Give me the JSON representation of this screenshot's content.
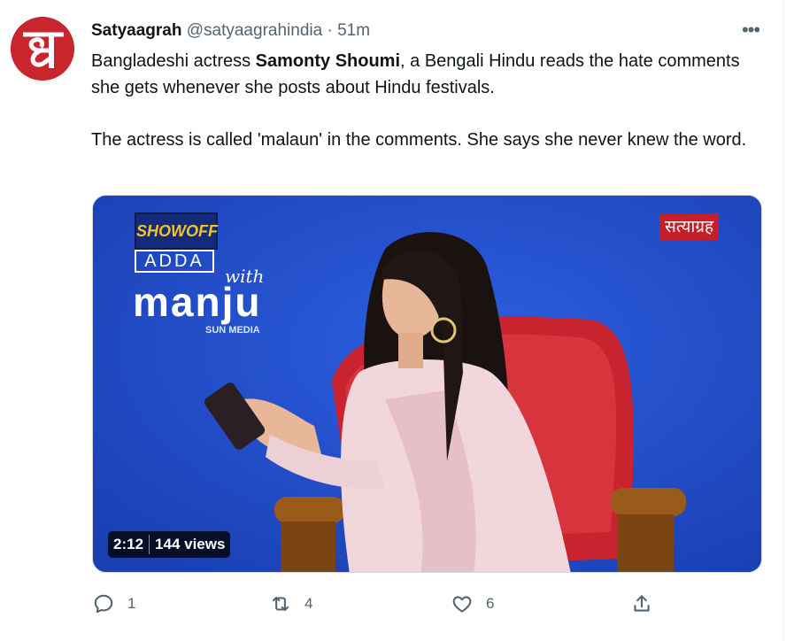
{
  "tweet": {
    "display_name": "Satyaagrah",
    "handle": "@satyaagrahindia",
    "separator": "·",
    "time": "51m",
    "text_p1_pre": "Bangladeshi actress ",
    "text_p1_bold": "Samonty Shoumi",
    "text_p1_post": ", a Bengali Hindu reads the hate comments she gets whenever she posts about Hindu festivals.",
    "text_p2": "The actress is called 'malaun' in the comments. She says she never knew the word.",
    "more_label": "•••"
  },
  "media": {
    "duration": "2:12",
    "views": "144 views",
    "overlay_logo_right": "सत्याग्रह",
    "overlay_showoff": "SHOWOFF",
    "overlay_adda": "ADDA",
    "overlay_with": "with",
    "overlay_manju": "manju",
    "overlay_sunmedia": "SUN MEDIA"
  },
  "actions": {
    "reply_count": "1",
    "retweet_count": "4",
    "like_count": "6"
  },
  "colors": {
    "avatar_bg": "#c8262c",
    "video_bg": "#1f4fd1",
    "icon_gray": "#536471"
  }
}
